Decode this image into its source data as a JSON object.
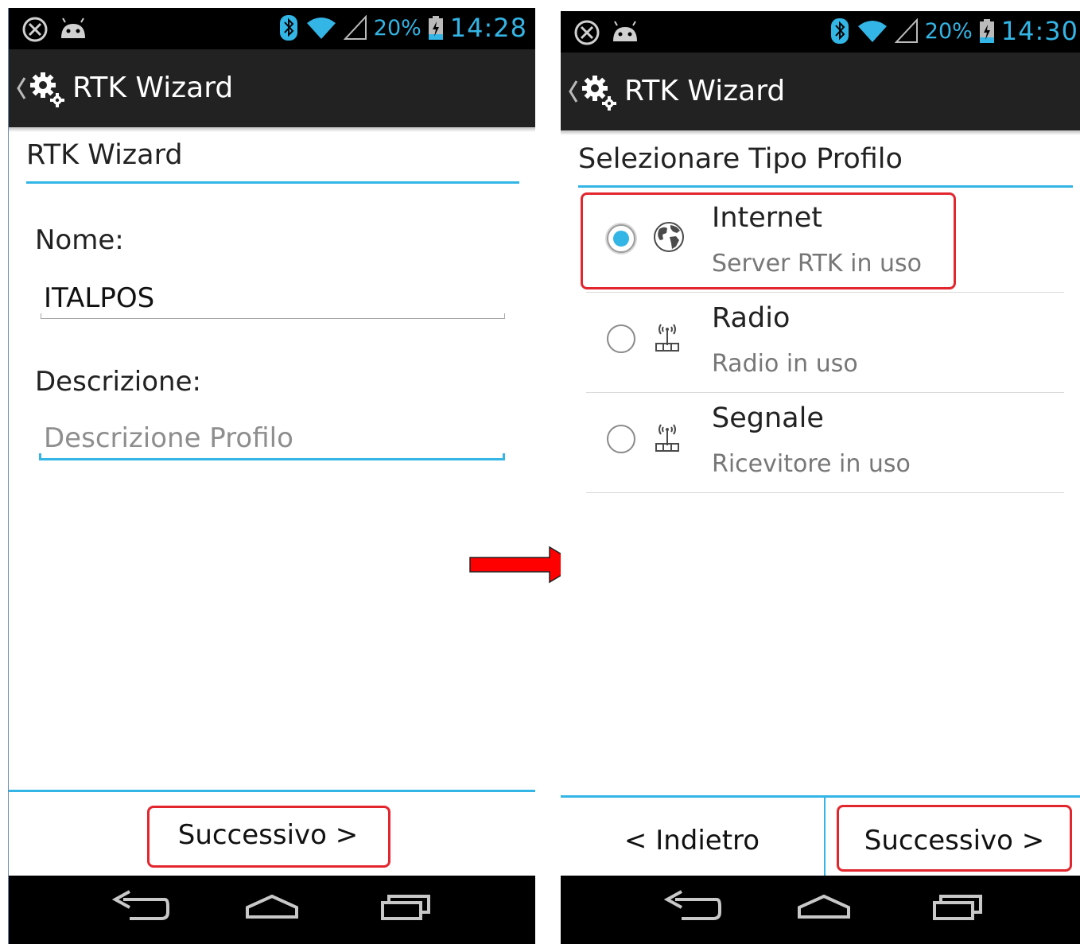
{
  "colors": {
    "accent": "#33b5e5",
    "highlight": "#e3262e",
    "actionbar": "#222222",
    "arrow": "#ff0000"
  },
  "screen1": {
    "status": {
      "battery": "20%",
      "time": "14:28"
    },
    "actionbar": {
      "title": "RTK Wizard",
      "icon": "settings-gears-icon"
    },
    "section_title": "RTK Wizard",
    "name_label": "Nome:",
    "name_value": "ITALPOS",
    "desc_label": "Descrizione:",
    "desc_placeholder": "Descrizione Profilo",
    "next_button": "Successivo >"
  },
  "screen2": {
    "status": {
      "battery": "20%",
      "time": "14:30"
    },
    "actionbar": {
      "title": "RTK Wizard",
      "icon": "settings-gears-icon"
    },
    "section_title": "Selezionare Tipo Profilo",
    "options": [
      {
        "title": "Internet",
        "subtitle": "Server RTK in uso",
        "icon": "globe-icon",
        "selected": true
      },
      {
        "title": "Radio",
        "subtitle": "Radio in uso",
        "icon": "antenna-icon",
        "selected": false
      },
      {
        "title": "Segnale",
        "subtitle": "Ricevitore in uso",
        "icon": "antenna-icon",
        "selected": false
      }
    ],
    "back_button": "< Indietro",
    "next_button": "Successivo >"
  }
}
